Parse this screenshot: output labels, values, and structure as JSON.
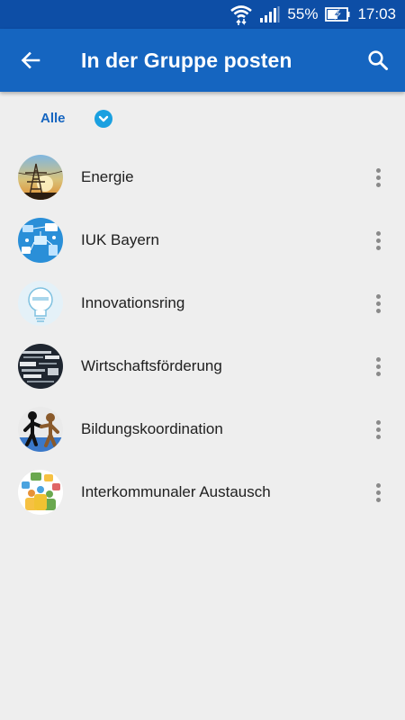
{
  "status_bar": {
    "battery_percent": "55%",
    "time": "17:03",
    "icons": [
      "wifi-icon",
      "signal-icon",
      "battery-charging-icon"
    ]
  },
  "app_bar": {
    "title": "In der Gruppe posten",
    "back_icon": "arrow-back-icon",
    "search_icon": "search-icon",
    "color": "#1565c0"
  },
  "filter": {
    "label": "Alle",
    "dropdown_icon": "chevron-down-icon",
    "accent": "#1aa0e0"
  },
  "groups": [
    {
      "name": "Energie",
      "avatar": "power-line-sunset-image"
    },
    {
      "name": "IUK Bayern",
      "avatar": "network-devices-image"
    },
    {
      "name": "Innovationsring",
      "avatar": "lightbulb-image"
    },
    {
      "name": "Wirtschaftsförderung",
      "avatar": "word-cloud-image"
    },
    {
      "name": "Bildungskoordination",
      "avatar": "silhouettes-image"
    },
    {
      "name": "Interkommunaler Austausch",
      "avatar": "people-speech-bubbles-image"
    }
  ]
}
